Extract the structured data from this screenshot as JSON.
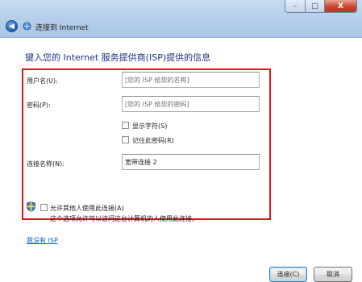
{
  "window": {
    "title": "连接到 Internet",
    "buttons": {
      "minimize": "–",
      "maximize": "□",
      "close": "X"
    }
  },
  "page": {
    "heading": "键入您的 Internet 服务提供商(ISP)提供的信息"
  },
  "form": {
    "username": {
      "label": "用户名(U):",
      "placeholder": "[您的 ISP 给您的名称]"
    },
    "password": {
      "label": "密码(P):",
      "placeholder": "[您的 ISP 给您的密码]"
    },
    "show_chars": {
      "label": "显示字符(S)",
      "checked": false
    },
    "remember_password": {
      "label": "记住此密码(R)",
      "checked": false
    },
    "connection_name": {
      "label": "连接名称(N):",
      "value": "宽带连接 2"
    }
  },
  "allow_others": {
    "label": "允许其他人使用此连接(A)",
    "checked": false,
    "note": "这个选项允许可以访问这台计算机的人使用此连接。"
  },
  "no_isp_link": "我没有 ISP",
  "footer": {
    "connect_label": "连接(C)",
    "cancel_label": "取消"
  },
  "icons": {
    "back": "back-arrow-icon",
    "wizard": "network-icon",
    "shield": "uac-shield-icon"
  }
}
